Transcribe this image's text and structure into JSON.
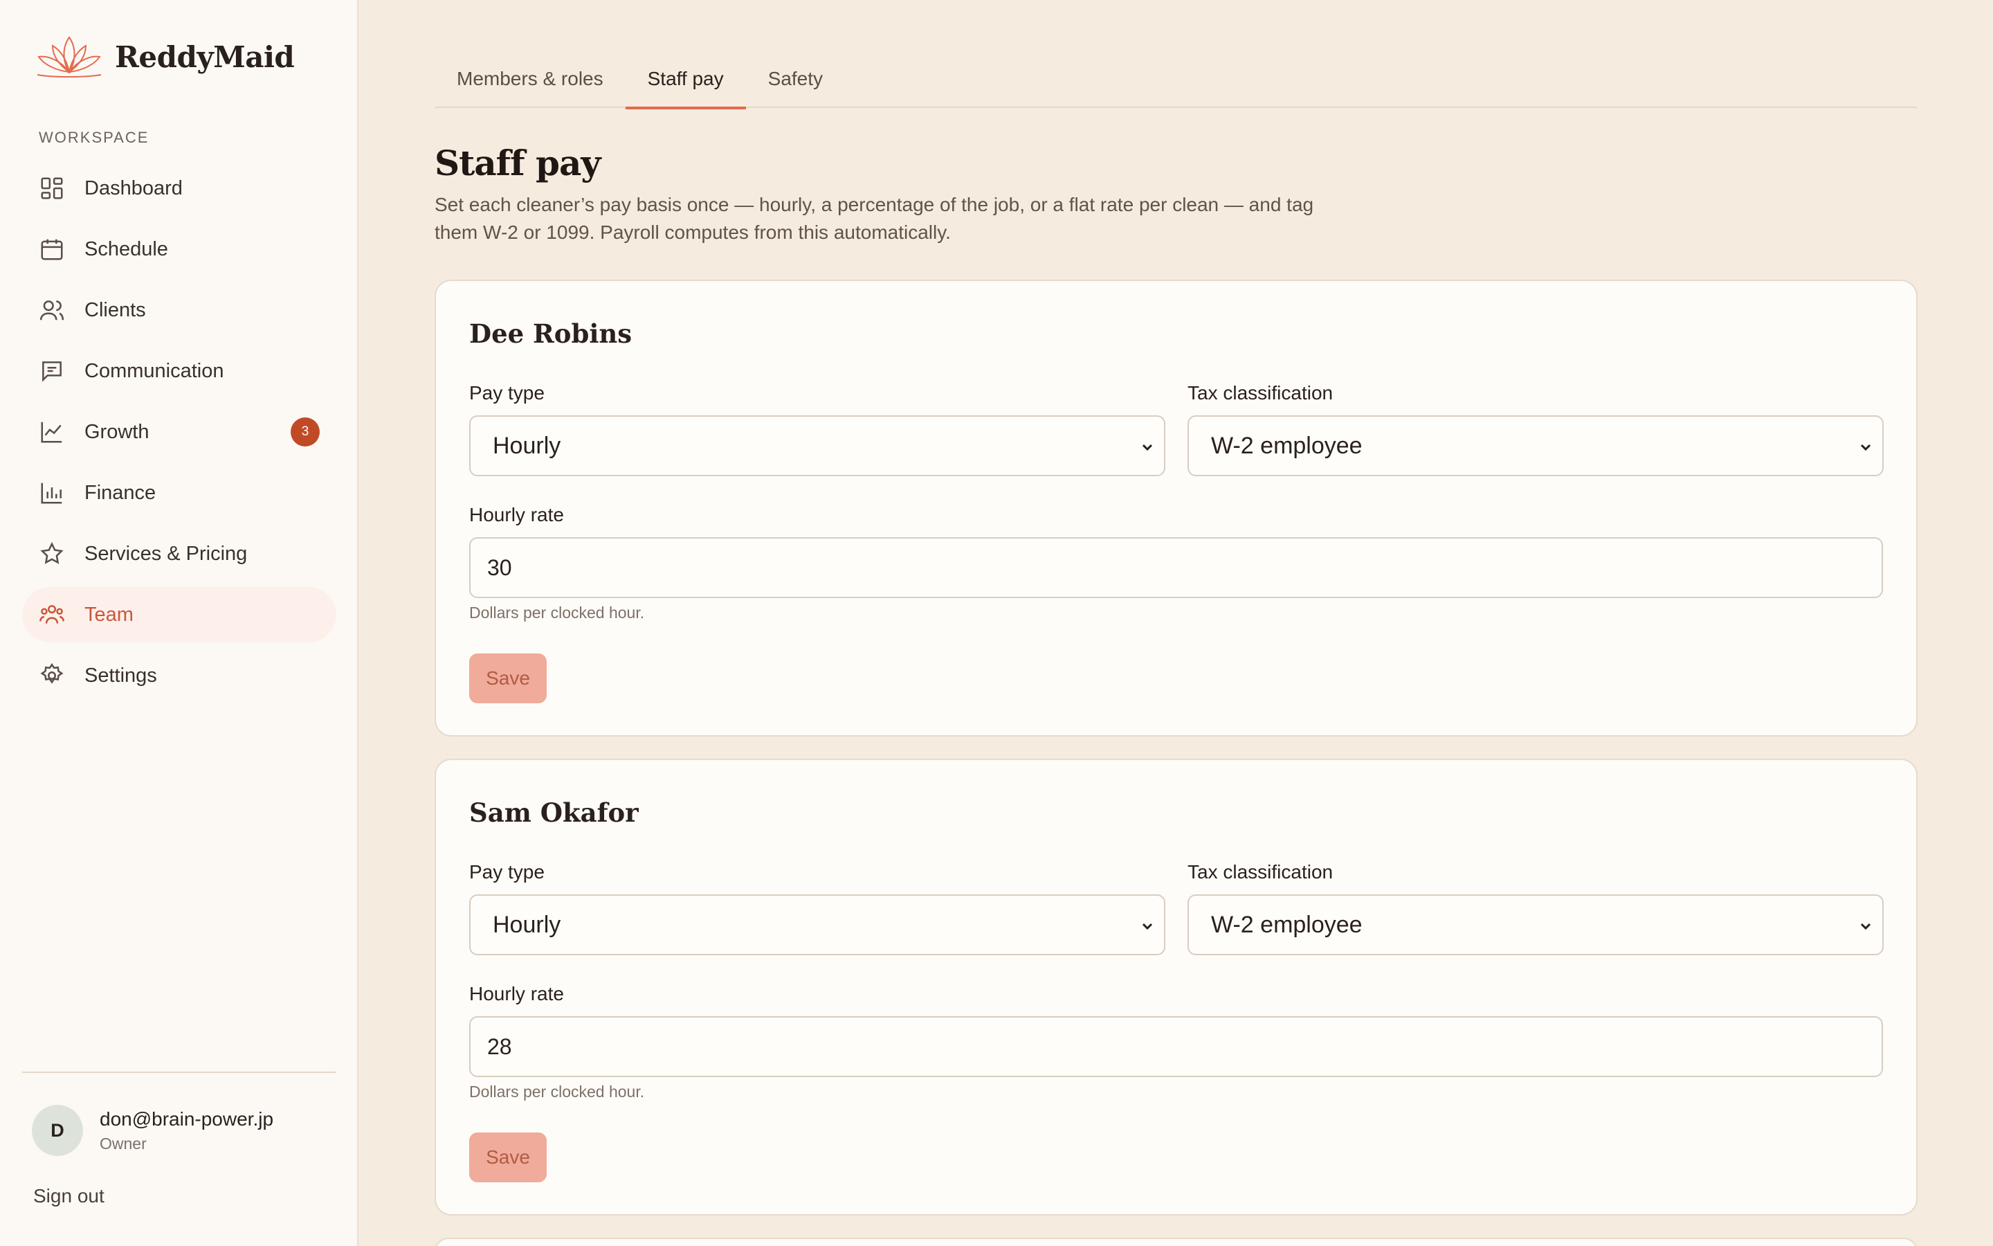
{
  "app": {
    "name": "ReddyMaid",
    "brand_color": "#e36b4e"
  },
  "sidebar": {
    "section_label": "WORKSPACE",
    "items": [
      {
        "label": "Dashboard",
        "icon": "dashboard-grid-icon"
      },
      {
        "label": "Schedule",
        "icon": "calendar-icon"
      },
      {
        "label": "Clients",
        "icon": "users-icon"
      },
      {
        "label": "Communication",
        "icon": "message-icon"
      },
      {
        "label": "Growth",
        "icon": "trend-chart-icon",
        "badge": "3"
      },
      {
        "label": "Finance",
        "icon": "bar-chart-icon"
      },
      {
        "label": "Services & Pricing",
        "icon": "star-icon"
      },
      {
        "label": "Team",
        "icon": "team-icon",
        "active": true
      },
      {
        "label": "Settings",
        "icon": "gear-icon"
      }
    ],
    "user": {
      "initial": "D",
      "email": "don@brain-power.jp",
      "role": "Owner"
    },
    "sign_out": "Sign out"
  },
  "tabs": [
    {
      "label": "Members & roles"
    },
    {
      "label": "Staff pay",
      "active": true
    },
    {
      "label": "Safety"
    }
  ],
  "page": {
    "title": "Staff pay",
    "description": "Set each cleaner’s pay basis once — hourly, a percentage of the job, or a flat rate per clean — and tag them W-2 or 1099. Payroll computes from this automatically."
  },
  "staff": [
    {
      "name": "Dee Robins",
      "pay_type_label": "Pay type",
      "pay_type": "Hourly",
      "tax_label": "Tax classification",
      "tax": "W-2 employee",
      "rate_label": "Hourly rate",
      "rate": "30",
      "hint": "Dollars per clocked hour.",
      "save": "Save"
    },
    {
      "name": "Sam Okafor",
      "pay_type_label": "Pay type",
      "pay_type": "Hourly",
      "tax_label": "Tax classification",
      "tax": "W-2 employee",
      "rate_label": "Hourly rate",
      "rate": "28",
      "hint": "Dollars per clocked hour.",
      "save": "Save"
    }
  ]
}
